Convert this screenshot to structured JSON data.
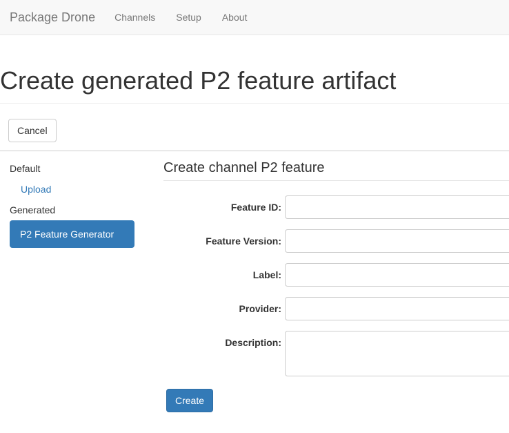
{
  "navbar": {
    "brand": "Package Drone",
    "items": [
      {
        "label": "Channels"
      },
      {
        "label": "Setup"
      },
      {
        "label": "About"
      }
    ]
  },
  "page": {
    "title": "Create generated P2 feature artifact"
  },
  "toolbar": {
    "cancel_label": "Cancel"
  },
  "sidebar": {
    "sections": [
      {
        "header": "Default",
        "items": [
          {
            "label": "Upload",
            "active": false
          }
        ]
      },
      {
        "header": "Generated",
        "items": [
          {
            "label": "P2 Feature Generator",
            "active": true
          }
        ]
      }
    ]
  },
  "form": {
    "heading": "Create channel P2 feature",
    "fields": [
      {
        "label": "Feature ID:",
        "value": "",
        "type": "text"
      },
      {
        "label": "Feature Version:",
        "value": "",
        "type": "text"
      },
      {
        "label": "Label:",
        "value": "",
        "type": "text"
      },
      {
        "label": "Provider:",
        "value": "",
        "type": "text"
      },
      {
        "label": "Description:",
        "value": "",
        "type": "textarea"
      }
    ],
    "submit_label": "Create"
  },
  "colors": {
    "accent": "#337ab7",
    "accent_border": "#2e6da4",
    "navbar_bg": "#f8f8f8",
    "navbar_text": "#777777",
    "link": "#337ab7"
  }
}
